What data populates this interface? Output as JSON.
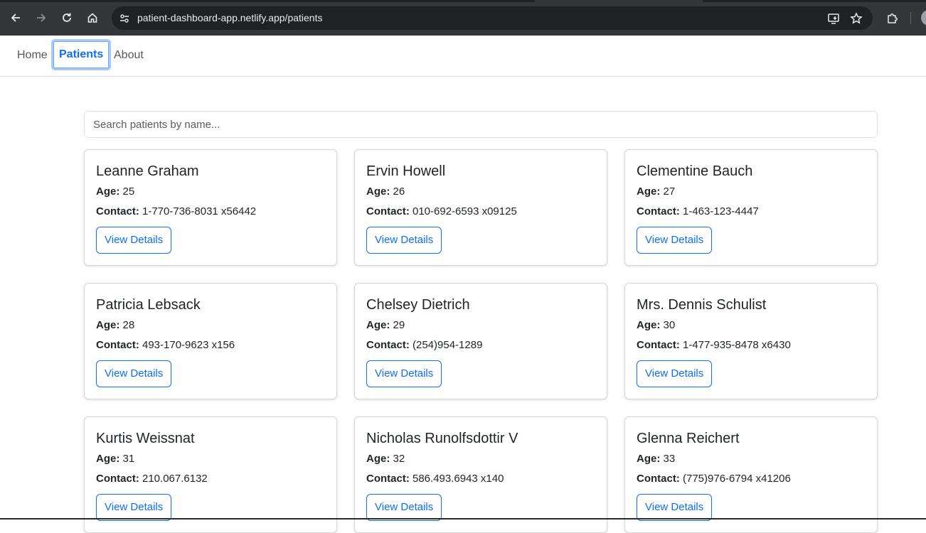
{
  "browser": {
    "url": "patient-dashboard-app.netlify.app/patients",
    "icons": [
      "back-arrow-icon",
      "forward-arrow-icon",
      "reload-icon",
      "home-icon",
      "site-info-icon",
      "install-app-icon",
      "bookmark-star-icon",
      "extensions-puzzle-icon"
    ]
  },
  "nav": {
    "home": "Home",
    "patients": "Patients",
    "about": "About",
    "active": "Patients"
  },
  "search": {
    "placeholder": "Search patients by name...",
    "value": ""
  },
  "labels": {
    "age": "Age:",
    "contact": "Contact:",
    "view_details": "View Details"
  },
  "patients": [
    {
      "name": "Leanne Graham",
      "age": "25",
      "contact": "1-770-736-8031 x56442"
    },
    {
      "name": "Ervin Howell",
      "age": "26",
      "contact": "010-692-6593 x09125"
    },
    {
      "name": "Clementine Bauch",
      "age": "27",
      "contact": "1-463-123-4447"
    },
    {
      "name": "Patricia Lebsack",
      "age": "28",
      "contact": "493-170-9623 x156"
    },
    {
      "name": "Chelsey Dietrich",
      "age": "29",
      "contact": "(254)954-1289"
    },
    {
      "name": "Mrs. Dennis Schulist",
      "age": "30",
      "contact": "1-477-935-8478 x6430"
    },
    {
      "name": "Kurtis Weissnat",
      "age": "31",
      "contact": "210.067.6132"
    },
    {
      "name": "Nicholas Runolfsdottir V",
      "age": "32",
      "contact": "586.493.6943 x140"
    },
    {
      "name": "Glenna Reichert",
      "age": "33",
      "contact": "(775)976-6794 x41206"
    }
  ],
  "colors": {
    "accent": "#0d6efd",
    "chrome_bg": "#35363a",
    "omnibox_bg": "#202124"
  }
}
